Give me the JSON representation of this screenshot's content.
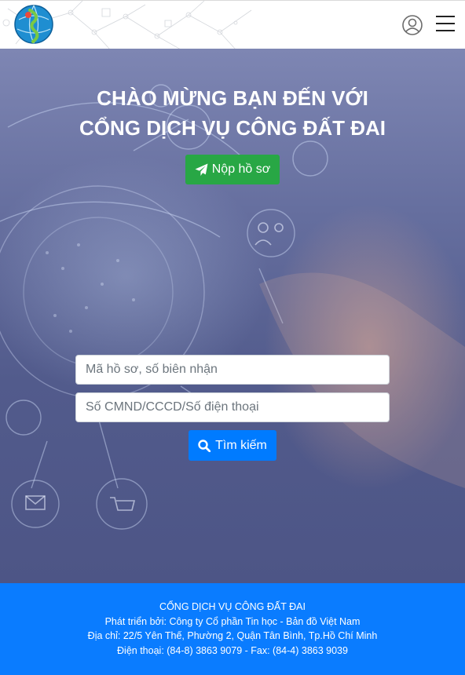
{
  "header": {
    "logo_icon": "globe-logo-icon",
    "user_icon": "user-circle-icon",
    "menu_icon": "hamburger-menu-icon"
  },
  "hero": {
    "title_line1": "CHÀO MỪNG BẠN ĐẾN VỚI",
    "title_line2": "CỔNG DỊCH VỤ CÔNG ĐẤT ĐAI",
    "submit_label": "Nộp hồ sơ",
    "submit_icon": "paper-plane-icon",
    "submit_color": "#28a745"
  },
  "search": {
    "code_placeholder": "Mã hồ sơ, số biên nhận",
    "code_value": "",
    "id_placeholder": "Số CMND/CCCD/Số điện thoại",
    "id_value": "",
    "button_label": "Tìm kiếm",
    "button_icon": "search-icon",
    "button_color": "#007bff"
  },
  "footer": {
    "background": "#0a7cff",
    "line1": "CỔNG DỊCH VỤ CÔNG ĐẤT ĐAI",
    "line2": "Phát triển bởi: Công ty Cổ phần Tin học - Bản đồ Việt Nam",
    "line3": "Địa chỉ: 22/5 Yên Thế, Phường 2, Quận Tân Bình, Tp.Hồ Chí Minh",
    "line4": "Điện thoại: (84-8) 3863 9079 - Fax: (84-4) 3863 9039"
  }
}
